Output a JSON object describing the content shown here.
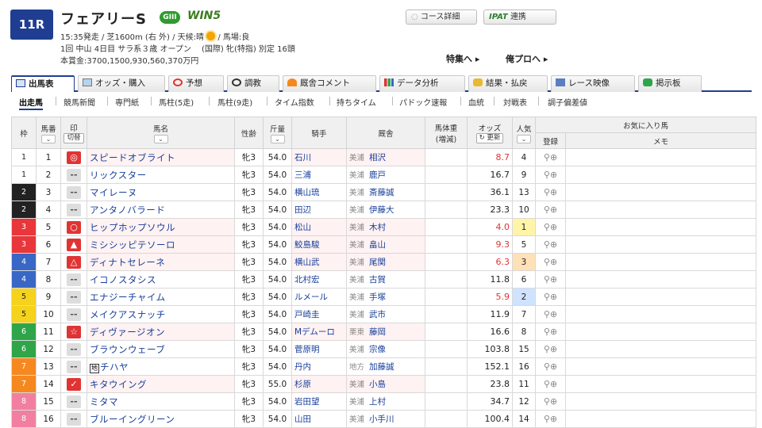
{
  "race": {
    "number": "11R",
    "title": "フェアリーS",
    "grade": "GIII",
    "win5": "WIN5",
    "line1_pre": "15:35発走 / 芝1600m (右 外) / 天候:晴",
    "line1_post": "/ 馬場:良",
    "line2": "1回 中山 4日目 サラ系３歳 オープン　 (国際) 牝(特指) 別定 16頭",
    "line3": "本賞金:3700,1500,930,560,370万円"
  },
  "header_buttons": {
    "course": "コース詳細",
    "ipat_logo": "IPAT",
    "ipat": "連携",
    "feature": "特集へ ▸",
    "pro": "俺プロへ ▸"
  },
  "tabs": [
    "出馬表",
    "オッズ・購入",
    "予想",
    "調教",
    "厩舎コメント",
    "データ分析",
    "結果・払戻",
    "レース映像",
    "掲示板"
  ],
  "subtabs": [
    "出走馬",
    "競馬新聞",
    "専門紙",
    "馬柱(5走)",
    "馬柱(9走)",
    "タイム指数",
    "持ちタイム",
    "パドック速報",
    "血統",
    "対戦表",
    "調子偏差値"
  ],
  "columns": {
    "waku": "枠",
    "umaban": "馬番",
    "mark": "印",
    "mark_sub": "切替",
    "name": "馬名",
    "sexage": "性齢",
    "weight": "斤量",
    "jockey": "騎手",
    "trainer": "厩舎",
    "bodyweight": "馬体重",
    "bodyweight_sub": "(増減)",
    "odds": "オッズ",
    "odds_btn": "↻ 更新",
    "pop": "人気",
    "fav": "お気に入り馬",
    "reg": "登録",
    "memo": "メモ"
  },
  "horses": [
    {
      "waku": "1",
      "ban": "1",
      "mark": "◎",
      "name": "スピードオブライト",
      "sa": "牝3",
      "kin": "54.0",
      "jockey": "石川",
      "loc": "美浦",
      "trainer": "相沢",
      "odds": "8.7",
      "pop": "4"
    },
    {
      "waku": "1",
      "ban": "2",
      "mark": "--",
      "name": "リックスター",
      "sa": "牝3",
      "kin": "54.0",
      "jockey": "三浦",
      "loc": "美浦",
      "trainer": "鹿戸",
      "odds": "16.7",
      "pop": "9"
    },
    {
      "waku": "2",
      "ban": "3",
      "mark": "--",
      "name": "マイレーヌ",
      "sa": "牝3",
      "kin": "54.0",
      "jockey": "横山琉",
      "loc": "美浦",
      "trainer": "斎藤誠",
      "odds": "36.1",
      "pop": "13"
    },
    {
      "waku": "2",
      "ban": "4",
      "mark": "--",
      "name": "アンタノバラード",
      "sa": "牝3",
      "kin": "54.0",
      "jockey": "田辺",
      "loc": "美浦",
      "trainer": "伊藤大",
      "odds": "23.3",
      "pop": "10"
    },
    {
      "waku": "3",
      "ban": "5",
      "mark": "○",
      "name": "ヒップホップソウル",
      "sa": "牝3",
      "kin": "54.0",
      "jockey": "松山",
      "loc": "美浦",
      "trainer": "木村",
      "odds": "4.0",
      "pop": "1"
    },
    {
      "waku": "3",
      "ban": "6",
      "mark": "▲",
      "name": "ミシシッピテソーロ",
      "sa": "牝3",
      "kin": "54.0",
      "jockey": "鮫島駿",
      "loc": "美浦",
      "trainer": "畠山",
      "odds": "9.3",
      "pop": "5"
    },
    {
      "waku": "4",
      "ban": "7",
      "mark": "△",
      "name": "ディナトセレーネ",
      "sa": "牝3",
      "kin": "54.0",
      "jockey": "横山武",
      "loc": "美浦",
      "trainer": "尾関",
      "odds": "6.3",
      "pop": "3"
    },
    {
      "waku": "4",
      "ban": "8",
      "mark": "--",
      "name": "イコノスタシス",
      "sa": "牝3",
      "kin": "54.0",
      "jockey": "北村宏",
      "loc": "美浦",
      "trainer": "古賀",
      "odds": "11.8",
      "pop": "6"
    },
    {
      "waku": "5",
      "ban": "9",
      "mark": "--",
      "name": "エナジーチャイム",
      "sa": "牝3",
      "kin": "54.0",
      "jockey": "ルメール",
      "loc": "美浦",
      "trainer": "手塚",
      "odds": "5.9",
      "pop": "2"
    },
    {
      "waku": "5",
      "ban": "10",
      "mark": "--",
      "name": "メイクアスナッチ",
      "sa": "牝3",
      "kin": "54.0",
      "jockey": "戸崎圭",
      "loc": "美浦",
      "trainer": "武市",
      "odds": "11.9",
      "pop": "7"
    },
    {
      "waku": "6",
      "ban": "11",
      "mark": "☆",
      "name": "ディヴァージオン",
      "sa": "牝3",
      "kin": "54.0",
      "jockey": "Mデムーロ",
      "loc": "栗東",
      "trainer": "藤岡",
      "odds": "16.6",
      "pop": "8"
    },
    {
      "waku": "6",
      "ban": "12",
      "mark": "--",
      "name": "ブラウンウェーブ",
      "sa": "牝3",
      "kin": "54.0",
      "jockey": "菅原明",
      "loc": "美浦",
      "trainer": "宗像",
      "odds": "103.8",
      "pop": "15"
    },
    {
      "waku": "7",
      "ban": "13",
      "mark": "--",
      "name": "チハヤ",
      "prefix": "地",
      "sa": "牝3",
      "kin": "54.0",
      "jockey": "丹内",
      "loc": "地方",
      "trainer": "加藤誠",
      "odds": "152.1",
      "pop": "16"
    },
    {
      "waku": "7",
      "ban": "14",
      "mark": "✓",
      "name": "キタウイング",
      "sa": "牝3",
      "kin": "55.0",
      "jockey": "杉原",
      "loc": "美浦",
      "trainer": "小島",
      "odds": "23.8",
      "pop": "11"
    },
    {
      "waku": "8",
      "ban": "15",
      "mark": "--",
      "name": "ミタマ",
      "sa": "牝3",
      "kin": "54.0",
      "jockey": "岩田望",
      "loc": "美浦",
      "trainer": "上村",
      "odds": "34.7",
      "pop": "12"
    },
    {
      "waku": "8",
      "ban": "16",
      "mark": "--",
      "name": "ブルーイングリーン",
      "sa": "牝3",
      "kin": "54.0",
      "jockey": "山田",
      "loc": "美浦",
      "trainer": "小手川",
      "odds": "100.4",
      "pop": "14"
    }
  ],
  "colors": {
    "accent": "#1f3e92",
    "odds_hot": "#e03434",
    "mark_red": "#e03434"
  }
}
